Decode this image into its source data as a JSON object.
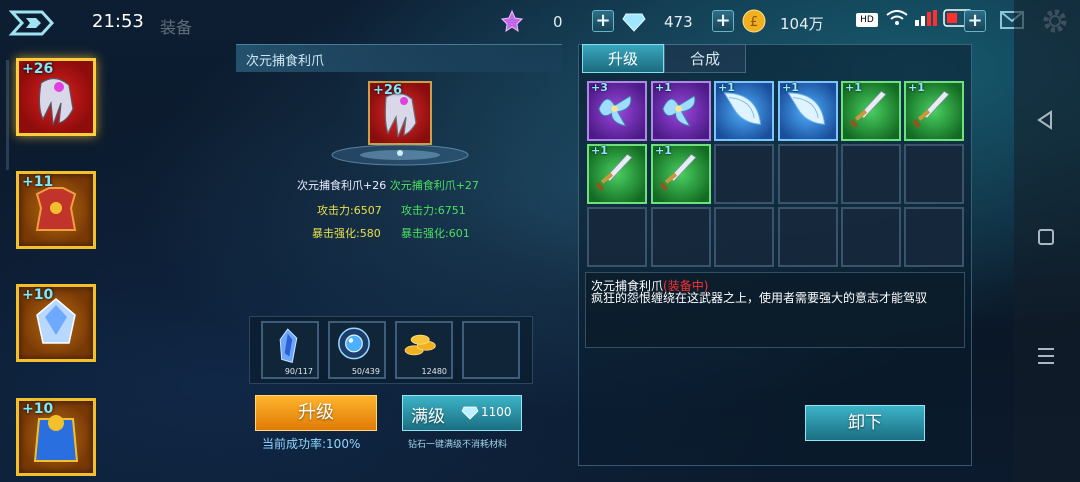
{
  "status_bar": {
    "time": "21:53",
    "title_ghost": "装备",
    "resource_1": "0",
    "resource_2": "473",
    "resource_3": "104万",
    "signal_text": "HD"
  },
  "equipment_list": [
    {
      "level": "+26",
      "icon": "claw-weapon-icon",
      "selected": true
    },
    {
      "level": "+11",
      "icon": "armor-icon",
      "selected": false
    },
    {
      "level": "+10",
      "icon": "crystal-icon",
      "selected": false
    },
    {
      "level": "+10",
      "icon": "cape-icon",
      "selected": false
    }
  ],
  "item_panel": {
    "title": "次元捕食利爪",
    "item_level": "+26",
    "current_name": "次元捕食利爪+26",
    "next_name": "次元捕食利爪+27",
    "attack_current": "攻击力:6507",
    "attack_next": "攻击力:6751",
    "crit_current": "暴击强化:580",
    "crit_next": "暴击强化:601"
  },
  "materials": [
    {
      "count": "90/117",
      "icon": "blue-shard-icon"
    },
    {
      "count": "50/439",
      "icon": "orb-icon"
    },
    {
      "count": "12480",
      "icon": "gold-coins-icon"
    },
    {
      "count": "",
      "icon": ""
    }
  ],
  "actions": {
    "upgrade_label": "升级",
    "success_rate": "当前成功率:100%",
    "max_label": "满级",
    "max_cost": "1100",
    "max_note": "钻石一键满级不消耗材料",
    "unequip_label": "卸下"
  },
  "tabs": {
    "upgrade": "升级",
    "synthesize": "合成"
  },
  "inventory": [
    {
      "level": "+3",
      "rarity": "purple",
      "icon": "axe-icon"
    },
    {
      "level": "+1",
      "rarity": "purple",
      "icon": "axe-icon"
    },
    {
      "level": "+1",
      "rarity": "blue",
      "icon": "crescent-blade-icon"
    },
    {
      "level": "+1",
      "rarity": "blue",
      "icon": "crescent-blade-icon"
    },
    {
      "level": "+1",
      "rarity": "green",
      "icon": "sword-icon"
    },
    {
      "level": "+1",
      "rarity": "green",
      "icon": "sword-icon"
    },
    {
      "level": "+1",
      "rarity": "green",
      "icon": "sword-icon"
    },
    {
      "level": "+1",
      "rarity": "green",
      "icon": "sword-icon"
    },
    {
      "level": "",
      "rarity": "empty",
      "icon": ""
    },
    {
      "level": "",
      "rarity": "empty",
      "icon": ""
    },
    {
      "level": "",
      "rarity": "empty",
      "icon": ""
    },
    {
      "level": "",
      "rarity": "empty",
      "icon": ""
    },
    {
      "level": "",
      "rarity": "empty",
      "icon": ""
    },
    {
      "level": "",
      "rarity": "empty",
      "icon": ""
    },
    {
      "level": "",
      "rarity": "empty",
      "icon": ""
    },
    {
      "level": "",
      "rarity": "empty",
      "icon": ""
    },
    {
      "level": "",
      "rarity": "empty",
      "icon": ""
    },
    {
      "level": "",
      "rarity": "empty",
      "icon": ""
    }
  ],
  "description": {
    "name": "次元捕食利爪",
    "status": "(装备中)",
    "text": "疯狂的怨恨缠绕在这武器之上，使用者需要强大的意志才能驾驭"
  }
}
